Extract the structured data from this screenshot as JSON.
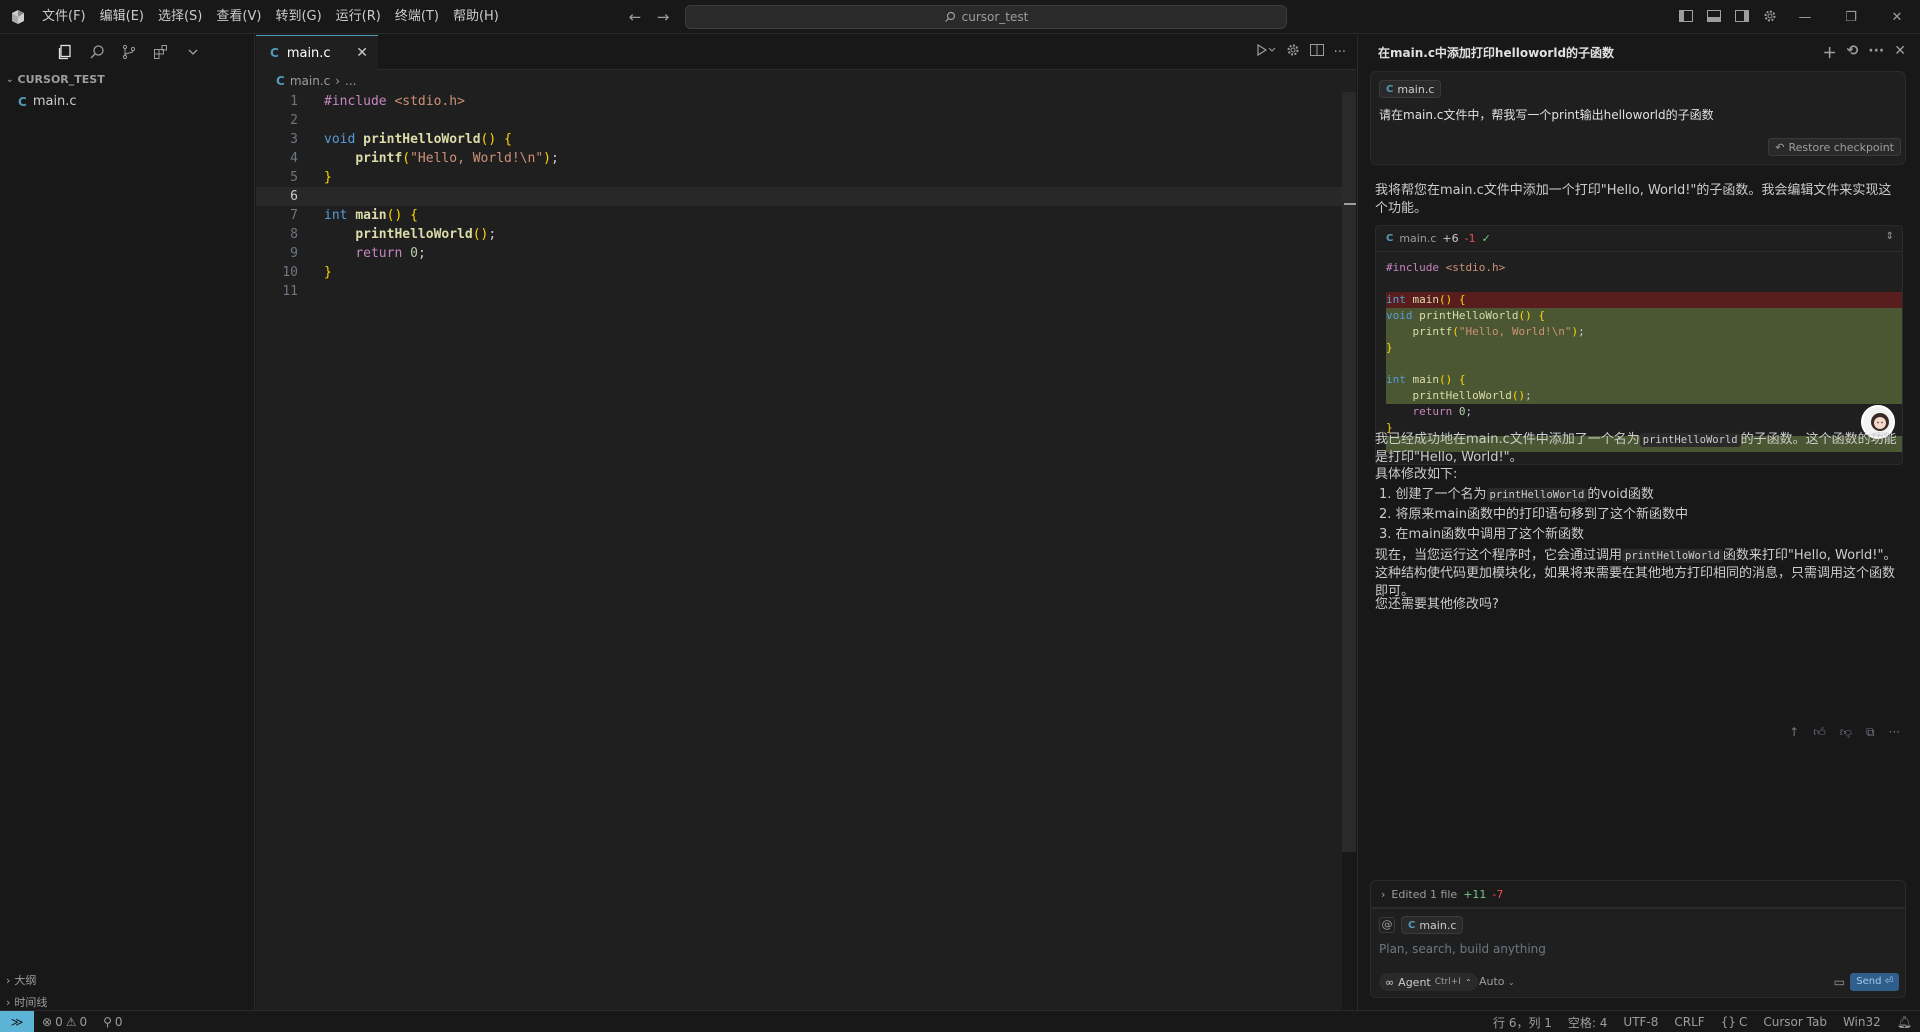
{
  "titlebar": {
    "menu": [
      "文件(F)",
      "编辑(E)",
      "选择(S)",
      "查看(V)",
      "转到(G)",
      "运行(R)",
      "终端(T)",
      "帮助(H)"
    ],
    "search_text": "cursor_test"
  },
  "sidebar": {
    "project": "CURSOR_TEST",
    "files": [
      {
        "icon": "C",
        "name": "main.c"
      }
    ],
    "outline_label": "大纲",
    "timeline_label": "时间线"
  },
  "editor": {
    "tab_label": "main.c",
    "tab_icon": "C",
    "breadcrumb_file": "main.c",
    "breadcrumb_more": "...",
    "current_line": 6
  },
  "chat": {
    "title": "在main.c中添加打印helloworld的子函数",
    "user_chip": "main.c",
    "user_message": "请在main.c文件中，帮我写一个print输出helloworld的子函数",
    "restore_label": "Restore checkpoint",
    "intro": "我将帮您在main.c文件中添加一个打印\"Hello, World!\"的子函数。我会编辑文件来实现这个功能。",
    "diff": {
      "file": "main.c",
      "added": "+6",
      "removed": "-1",
      "check": "✓"
    },
    "summary_a": "我已经成功地在main.c文件中添加了一个名为",
    "summary_code": "printHelloWorld",
    "summary_b": "的子函数。这个函数的功能是打印\"Hello, World!\"。",
    "changes_heading": "具体修改如下:",
    "change1_a": "1. 创建了一个名为",
    "change1_code": "printHelloWorld",
    "change1_b": "的void函数",
    "change2": "2. 将原来main函数中的打印语句移到了这个新函数中",
    "change3": "3. 在main函数中调用了这个新函数",
    "outro_a": "现在，当您运行这个程序时，它会通过调用",
    "outro_code": "printHelloWorld",
    "outro_b": "函数来打印\"Hello, World!\"。这种结构使代码更加模块化，如果将来需要在其他地方打印相同的消息，只需调用这个函数即可。",
    "question": "您还需要其他修改吗?",
    "edited_label": "Edited 1 file",
    "edited_added": "+11",
    "edited_removed": "-7",
    "composer_chip": "main.c",
    "composer_placeholder": "Plan, search, build anything",
    "agent_label": "Agent",
    "agent_shortcut": "Ctrl+I",
    "model_label": "Auto",
    "send_label": "Send"
  },
  "statusbar": {
    "errors": "0",
    "warnings": "0",
    "ports": "0",
    "position": "行 6，列 1",
    "spaces": "空格: 4",
    "encoding": "UTF-8",
    "eol": "CRLF",
    "language": "C",
    "cursor_tab": "Cursor Tab",
    "platform": "Win32"
  },
  "icons": [
    "cursor-logo-icon",
    "files-icon",
    "search-icon",
    "source-control-icon",
    "extensions-icon",
    "chevron-down-icon",
    "run-icon",
    "gear-icon",
    "split-editor-icon",
    "more-icon",
    "plus-icon",
    "history-icon",
    "close-icon",
    "thumbs-up-icon",
    "thumbs-down-icon",
    "copy-icon",
    "bell-icon"
  ],
  "colors": {
    "accent": "#519aba",
    "remote": "#5bb3d6",
    "diff_add": "#4b5632",
    "diff_del": "#5a1d1d"
  }
}
